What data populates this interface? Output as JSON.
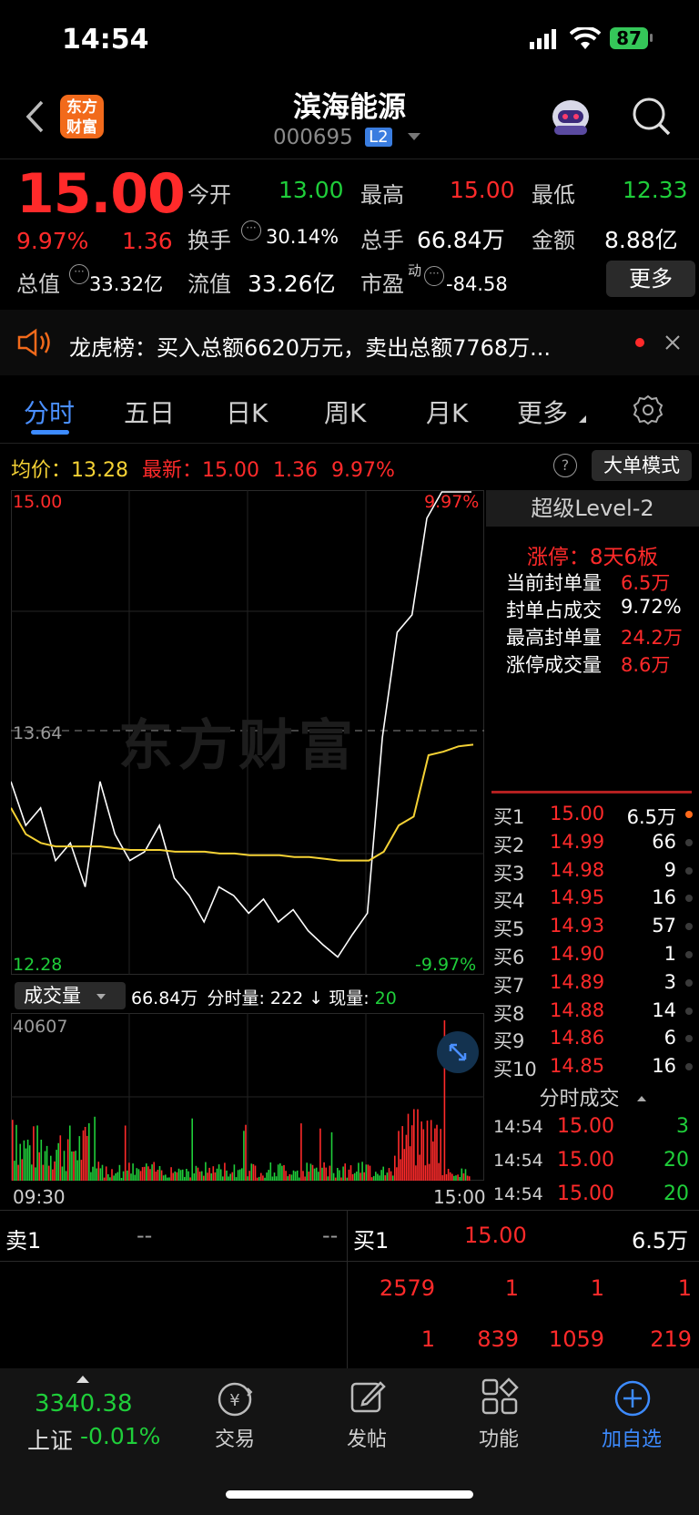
{
  "status_bar": {
    "time": "14:54",
    "battery": "87"
  },
  "header": {
    "logo_text": "东方财富",
    "title": "滨海能源",
    "code": "000695",
    "level_badge": "L2"
  },
  "quote": {
    "price": "15.00",
    "change_pct": "9.97%",
    "change": "1.36",
    "open_label": "今开",
    "open": "13.00",
    "high_label": "最高",
    "high": "15.00",
    "low_label": "最低",
    "low": "12.33",
    "turnover_label": "换手",
    "turnover": "30.14%",
    "volume_label": "总手",
    "volume": "66.84万",
    "amount_label": "金额",
    "amount": "8.88亿",
    "mktcap_label": "总值",
    "mktcap": "33.32亿",
    "float_label": "流值",
    "float": "33.26亿",
    "pe_label": "市盈",
    "pe_sup": "动",
    "pe": "-84.58",
    "more_button": "更多"
  },
  "notice": {
    "text": "龙虎榜：买入总额6620万元，卖出总额7768万..."
  },
  "tabs": [
    "分时",
    "五日",
    "日K",
    "周K",
    "月K",
    "更多"
  ],
  "chart_header": {
    "avg_label": "均价：",
    "avg": "13.28",
    "latest_label": "最新：",
    "latest": "15.00",
    "chg": "1.36",
    "pct": "9.97%",
    "mode_button": "大单模式"
  },
  "chart_labels": {
    "top_price": "15.00",
    "top_pct": "9.97%",
    "mid_price": "13.64",
    "bottom_price": "12.28",
    "bottom_pct": "-9.97%",
    "watermark": "东方财富",
    "vol_selector": "成交量",
    "vol_info_total": "66.84万",
    "vol_info_minute_label": "分时量:",
    "vol_info_minute": "222",
    "vol_info_now_label": "现量:",
    "vol_info_now": "20",
    "vol_max": "40607",
    "time_start": "09:30",
    "time_end": "15:00"
  },
  "chart_data": {
    "type": "line",
    "title": "",
    "xlabel": "",
    "ylabel": "",
    "ylim": [
      12.28,
      15.0
    ],
    "x_range": [
      "09:30",
      "15:00"
    ],
    "prev_close": 13.64,
    "series": [
      {
        "values": [
          13.35,
          13.1,
          13.2,
          12.9,
          13.0,
          12.75,
          13.35,
          13.05,
          12.9,
          12.95,
          13.1,
          12.8,
          12.7,
          12.55,
          12.75,
          12.7,
          12.6,
          12.68,
          12.55,
          12.62,
          12.5,
          12.42,
          12.35,
          12.48,
          12.6,
          13.6,
          14.2,
          14.3,
          14.85,
          15.0,
          15.0,
          15.0
        ]
      },
      {
        "values": [
          13.2,
          13.05,
          13.0,
          12.98,
          12.98,
          12.98,
          12.98,
          12.97,
          12.96,
          12.96,
          12.96,
          12.95,
          12.95,
          12.95,
          12.94,
          12.94,
          12.93,
          12.93,
          12.93,
          12.92,
          12.92,
          12.91,
          12.9,
          12.9,
          12.9,
          12.95,
          13.1,
          13.15,
          13.5,
          13.52,
          13.55,
          13.56
        ]
      }
    ]
  },
  "level2": {
    "title": "超级Level-2",
    "limit_up": "涨停：8天6板",
    "stats": [
      {
        "label": "当前封单量",
        "value": "6.5万"
      },
      {
        "label": "封单占成交",
        "value": "9.72%"
      },
      {
        "label": "最高封单量",
        "value": "24.2万"
      },
      {
        "label": "涨停成交量",
        "value": "8.6万"
      }
    ]
  },
  "bids": [
    {
      "label": "买1",
      "price": "15.00",
      "qty": "6.5万"
    },
    {
      "label": "买2",
      "price": "14.99",
      "qty": "66"
    },
    {
      "label": "买3",
      "price": "14.98",
      "qty": "9"
    },
    {
      "label": "买4",
      "price": "14.95",
      "qty": "16"
    },
    {
      "label": "买5",
      "price": "14.93",
      "qty": "57"
    },
    {
      "label": "买6",
      "price": "14.90",
      "qty": "1"
    },
    {
      "label": "买7",
      "price": "14.89",
      "qty": "3"
    },
    {
      "label": "买8",
      "price": "14.88",
      "qty": "14"
    },
    {
      "label": "买9",
      "price": "14.86",
      "qty": "6"
    },
    {
      "label": "买10",
      "price": "14.85",
      "qty": "16"
    }
  ],
  "ticks": {
    "title": "分时成交",
    "rows": [
      {
        "time": "14:54",
        "price": "15.00",
        "qty": "3"
      },
      {
        "time": "14:54",
        "price": "15.00",
        "qty": "20"
      },
      {
        "time": "14:54",
        "price": "15.00",
        "qty": "20"
      }
    ]
  },
  "queue": {
    "sell_label": "卖1",
    "sell_price": "--",
    "sell_qty": "--",
    "buy_label": "买1",
    "buy_price": "15.00",
    "buy_qty": "6.5万",
    "row1": [
      "2579",
      "1",
      "1",
      "1"
    ],
    "row2": [
      "1",
      "839",
      "1059",
      "219"
    ]
  },
  "bottom_nav": {
    "index_value": "3340.38",
    "index_name": "上证",
    "index_pct": "-0.01%",
    "items": [
      "交易",
      "发帖",
      "功能",
      "加自选"
    ]
  },
  "colors": {
    "up": "#ff2a2a",
    "down": "#1fce3a",
    "avg_line": "#f5d235",
    "accent": "#3d8bff"
  }
}
